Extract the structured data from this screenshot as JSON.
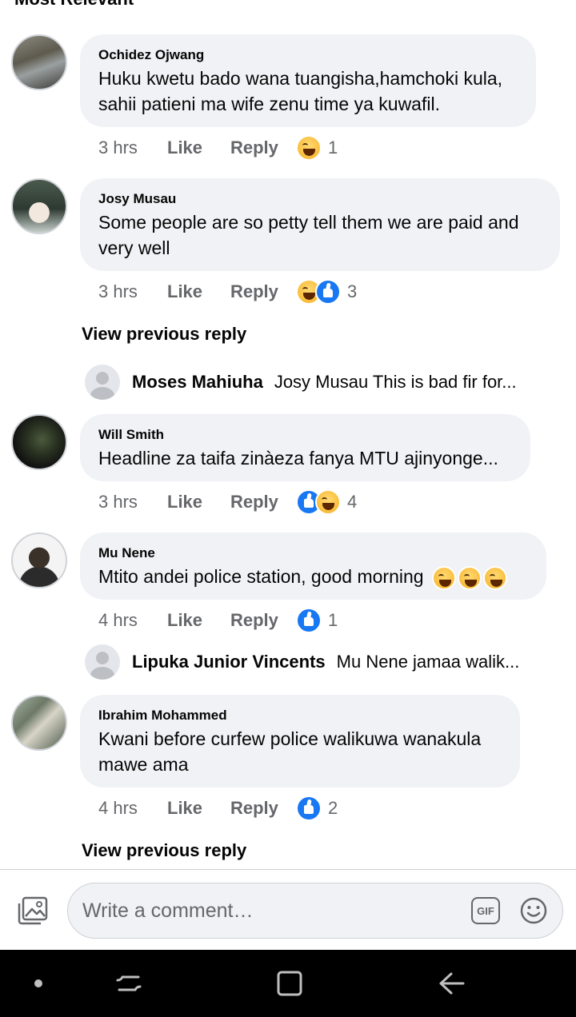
{
  "sort_label": "Most Relevant",
  "comments": [
    {
      "author": "Ochidez Ojwang",
      "text": "Huku kwetu bado wana tuangisha,hamchoki kula, sahii patieni ma wife zenu time ya kuwafil.",
      "time": "3 hrs",
      "like": "Like",
      "reply": "Reply",
      "reactions": [
        "haha-icon"
      ],
      "count": "1"
    },
    {
      "author": "Josy Musau",
      "text": "Some people  are so petty tell them we are paid and very well",
      "time": "3 hrs",
      "like": "Like",
      "reply": "Reply",
      "reactions": [
        "haha-icon",
        "like-icon"
      ],
      "count": "3"
    },
    {
      "author": "Will Smith",
      "text": "Headline za taifa zinàeza fanya MTU ajinyonge...",
      "time": "3 hrs",
      "like": "Like",
      "reply": "Reply",
      "reactions": [
        "like-icon",
        "haha-icon"
      ],
      "count": "4"
    },
    {
      "author": "Mu Nene",
      "text": "Mtito andei police station, good morning",
      "time": "4 hrs",
      "like": "Like",
      "reply": "Reply",
      "reactions": [
        "like-icon"
      ],
      "count": "1"
    },
    {
      "author": "Ibrahim Mohammed",
      "text": "Kwani before curfew police walikuwa wanakula mawe ama",
      "time": "4 hrs",
      "like": "Like",
      "reply": "Reply",
      "reactions": [
        "like-icon"
      ],
      "count": "2"
    }
  ],
  "view_previous_reply": "View previous reply",
  "replies": [
    {
      "author": "Moses Mahiuha",
      "text": "Josy Musau This is bad fir for..."
    },
    {
      "author": "Lipuka Junior Vincents",
      "text": "Mu Nene  jamaa walik..."
    }
  ],
  "composer": {
    "placeholder": "Write a comment…",
    "gif_label": "GIF",
    "icons": [
      "photo-icon",
      "gif-icon",
      "emoji-icon"
    ]
  },
  "navbar": {
    "icons": [
      "dot-icon",
      "recent-apps-icon",
      "home-icon",
      "back-icon"
    ]
  },
  "colors": {
    "bubble": "#f0f2f5",
    "meta_text": "#65676b",
    "like_blue": "#1877f2",
    "haha_yellow": "#f7b125",
    "navbar": "#000000"
  }
}
